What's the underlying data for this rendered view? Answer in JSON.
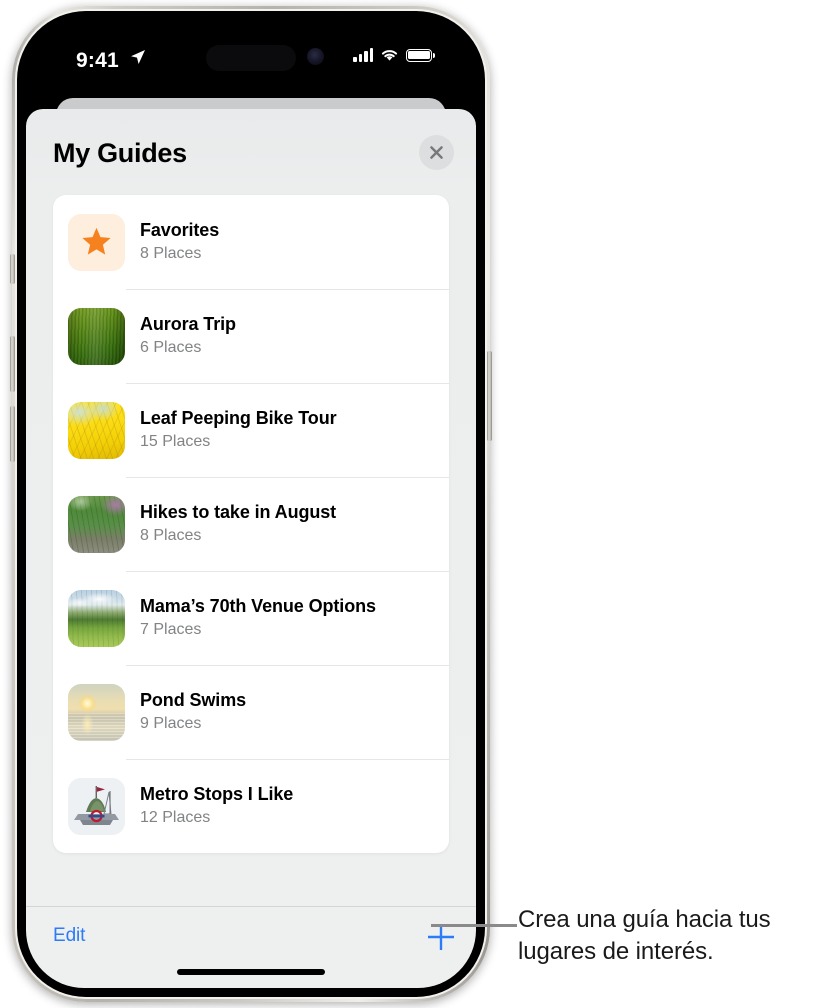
{
  "status_bar": {
    "time": "9:41",
    "location_icon": "location-arrow-icon",
    "signal_icon": "cellular-bars-icon",
    "wifi_icon": "wifi-icon",
    "battery_icon": "battery-full-icon"
  },
  "sheet": {
    "title": "My Guides",
    "close_icon": "close-x-icon"
  },
  "guides": [
    {
      "title": "Favorites",
      "places": "8 Places",
      "thumb": "th-fav",
      "icon": "star-icon"
    },
    {
      "title": "Aurora Trip",
      "places": "6 Places",
      "thumb": "th-aurora",
      "icon": "photo-thumbnail"
    },
    {
      "title": "Leaf Peeping Bike Tour",
      "places": "15 Places",
      "thumb": "th-leaf",
      "icon": "photo-thumbnail"
    },
    {
      "title": "Hikes to take in August",
      "places": "8 Places",
      "thumb": "th-hikes",
      "icon": "photo-thumbnail"
    },
    {
      "title": "Mama’s 70th Venue Options",
      "places": "7 Places",
      "thumb": "th-mama",
      "icon": "photo-thumbnail"
    },
    {
      "title": "Pond Swims",
      "places": "9 Places",
      "thumb": "th-pond",
      "icon": "photo-thumbnail"
    },
    {
      "title": "Metro Stops I Like",
      "places": "12 Places",
      "thumb": "th-metro",
      "icon": "photo-thumbnail"
    }
  ],
  "toolbar": {
    "edit_label": "Edit",
    "add_icon": "plus-icon"
  },
  "callout": {
    "text": "Crea una guía hacia tus lugares de interés."
  },
  "colors": {
    "accent_blue": "#2b7cf6",
    "star_orange": "#f5821f",
    "star_bg": "#fdeedd",
    "sheet_bg": "#eceeee",
    "card_bg": "#ffffff",
    "subtitle_gray": "#818385",
    "callout_line": "#8a8a8a"
  }
}
